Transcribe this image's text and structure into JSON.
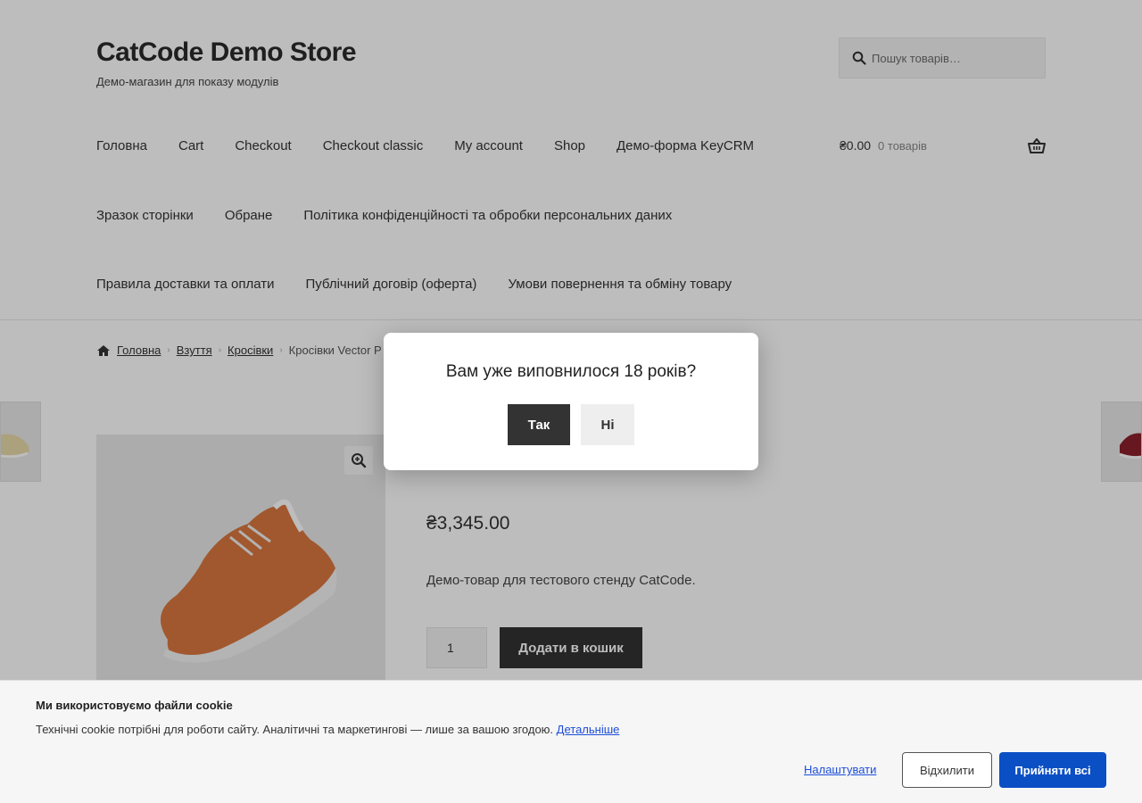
{
  "header": {
    "site_title": "CatCode Demo Store",
    "tagline": "Демо-магазин для показу модулів",
    "search_placeholder": "Пошук товарів…"
  },
  "nav": {
    "row1": [
      "Головна",
      "Cart",
      "Checkout",
      "Checkout classic",
      "My account",
      "Shop",
      "Демо-форма KeyCRM"
    ],
    "row2": [
      "Зразок сторінки",
      "Обране",
      "Політика конфіденційності та обробки персональних даних"
    ],
    "row3": [
      "Правила доставки та оплати",
      "Публічний договір (оферта)",
      "Умови повернення та обміну товару"
    ]
  },
  "cart": {
    "amount": "₴0.00",
    "count": "0 товарів"
  },
  "breadcrumb": {
    "items": [
      "Головна",
      "Взуття",
      "Кросівки"
    ],
    "current": "Кросівки Vector P"
  },
  "product": {
    "price": "₴3,345.00",
    "description": "Демо-товар для тестового стенду CatCode.",
    "quantity": "1",
    "add_to_cart": "Додати в кошик"
  },
  "age_modal": {
    "question": "Вам уже виповнилося 18 років?",
    "yes": "Так",
    "no": "Ні"
  },
  "cookie": {
    "title": "Ми використовуємо файли cookie",
    "text": "Технічні cookie потрібні для роботи сайту. Аналітичні та маркетингові — лише за вашою згодою.",
    "details_link": "Детальніше",
    "settings": "Налаштувати",
    "reject": "Відхилити",
    "accept": "Прийняти всі"
  },
  "colors": {
    "accent_blue": "#0b4fc4",
    "dark_button": "#333333",
    "shoe_orange": "#d9773f"
  }
}
